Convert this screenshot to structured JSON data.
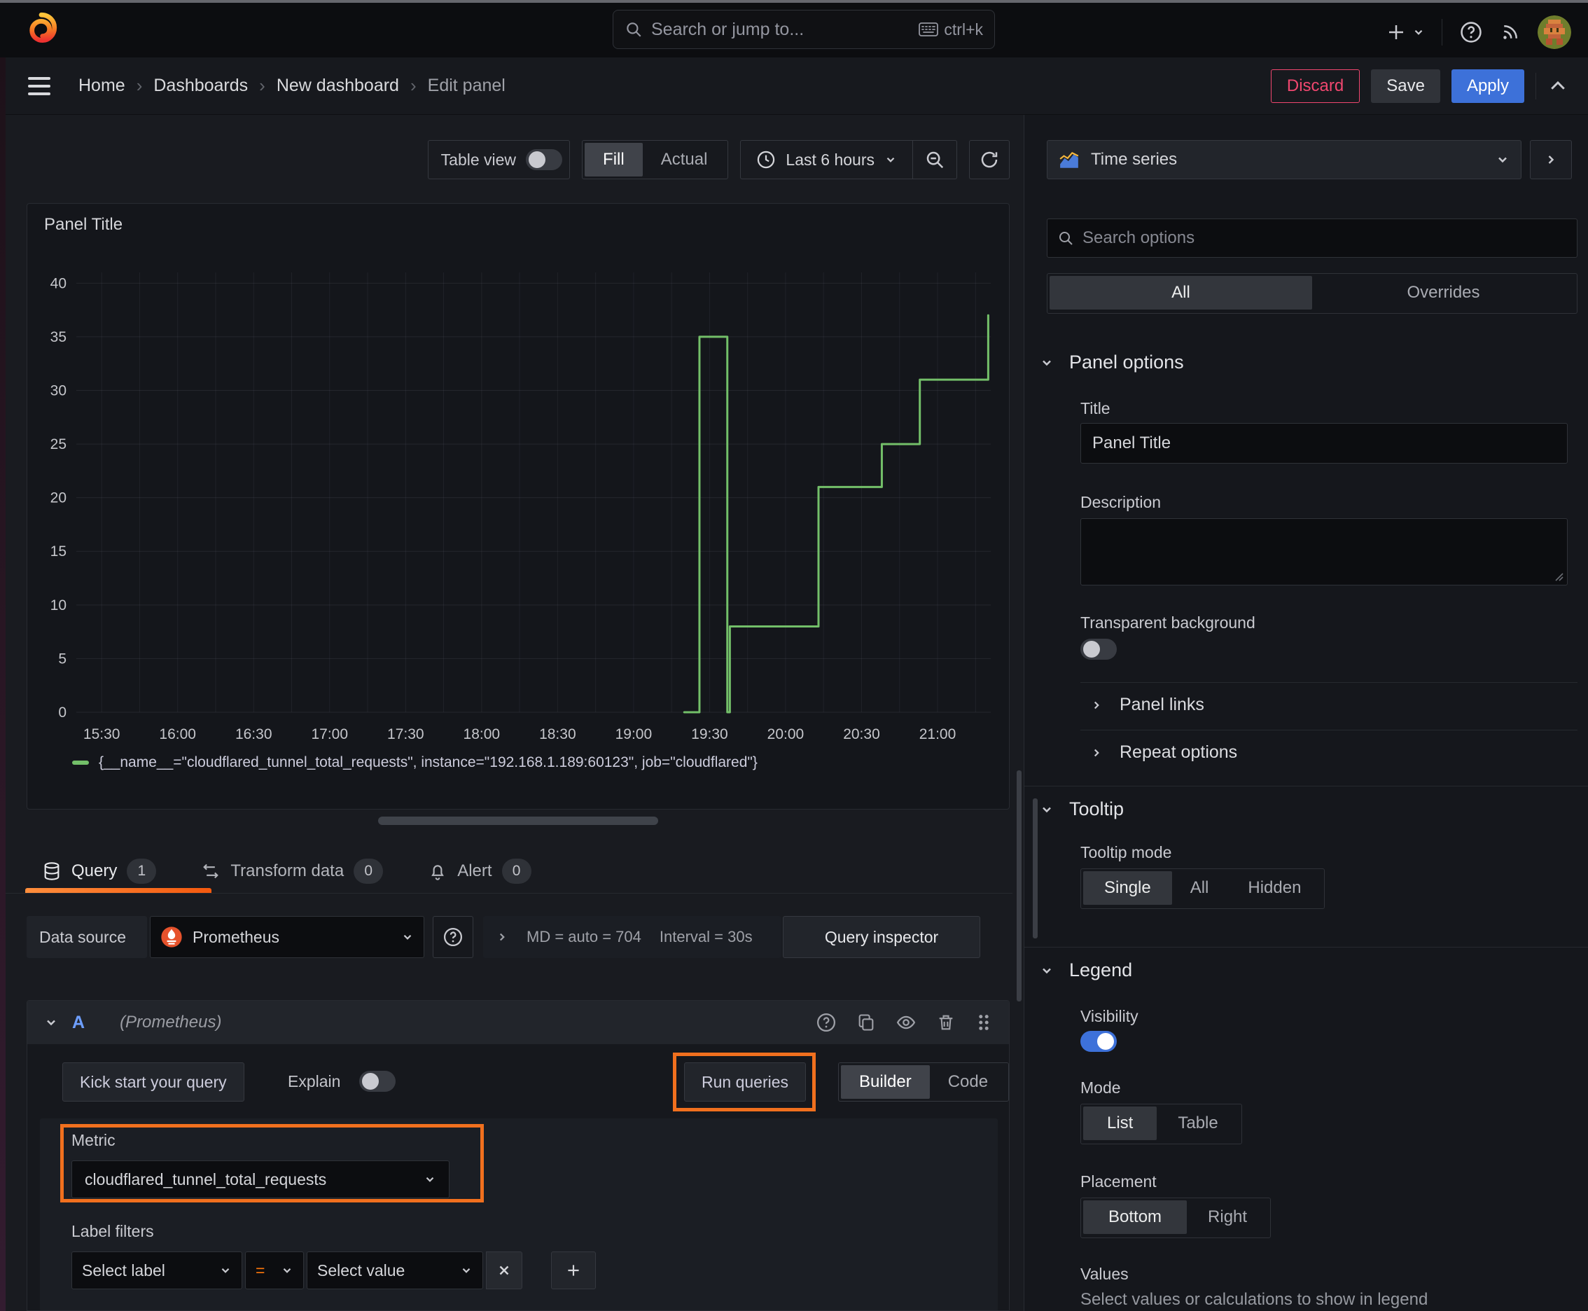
{
  "topbar": {
    "search_placeholder": "Search or jump to...",
    "search_shortcut": "ctrl+k"
  },
  "breadcrumb": {
    "items": [
      "Home",
      "Dashboards",
      "New dashboard",
      "Edit panel"
    ]
  },
  "header_actions": {
    "discard": "Discard",
    "save": "Save",
    "apply": "Apply"
  },
  "panel_toolbar": {
    "table_view": "Table view",
    "fill": "Fill",
    "actual": "Actual",
    "time_range": "Last 6 hours"
  },
  "viz_picker": {
    "label": "Time series"
  },
  "panel": {
    "title": "Panel Title"
  },
  "chart_data": {
    "type": "line",
    "line_interpolation": "step-after",
    "title": "Panel Title",
    "x_range": [
      "15:20",
      "21:21"
    ],
    "x_ticks": [
      "15:30",
      "16:00",
      "16:30",
      "17:00",
      "17:30",
      "18:00",
      "18:30",
      "19:00",
      "19:30",
      "20:00",
      "20:30",
      "21:00"
    ],
    "y_ticks": [
      0,
      5,
      10,
      15,
      20,
      25,
      30,
      35,
      40
    ],
    "ylim": [
      0,
      41
    ],
    "grid": true,
    "legend_position": "bottom",
    "series": [
      {
        "name": "{__name__=\"cloudflared_tunnel_total_requests\", instance=\"192.168.1.189:60123\", job=\"cloudflared\"}",
        "color": "#73bf69",
        "points": [
          [
            "19:20",
            0
          ],
          [
            "19:26",
            35
          ],
          [
            "19:37",
            0
          ],
          [
            "19:38",
            8
          ],
          [
            "20:13",
            21
          ],
          [
            "20:38",
            25
          ],
          [
            "20:53",
            31
          ],
          [
            "21:20",
            37
          ]
        ]
      }
    ]
  },
  "editor_tabs": {
    "query": {
      "label": "Query",
      "count": "1"
    },
    "transform": {
      "label": "Transform data",
      "count": "0"
    },
    "alert": {
      "label": "Alert",
      "count": "0"
    }
  },
  "datasource_row": {
    "label": "Data source",
    "value": "Prometheus",
    "stats": "MD = auto = 704",
    "interval": "Interval = 30s",
    "inspector": "Query inspector"
  },
  "query_editor": {
    "ref_id": "A",
    "ds_hint": "(Prometheus)",
    "kickstart": "Kick start your query",
    "explain": "Explain",
    "run": "Run queries",
    "builder": "Builder",
    "code": "Code",
    "metric_label": "Metric",
    "metric_value": "cloudflared_tunnel_total_requests",
    "label_filters": "Label filters",
    "select_label": "Select label",
    "operator": "=",
    "select_value": "Select value"
  },
  "sidebar": {
    "search_placeholder": "Search options",
    "tabs": {
      "all": "All",
      "overrides": "Overrides"
    },
    "panel_options": {
      "title": "Panel options",
      "title_label": "Title",
      "title_value": "Panel Title",
      "description_label": "Description",
      "transparent_label": "Transparent background"
    },
    "collapsed": {
      "panel_links": "Panel links",
      "repeat_options": "Repeat options"
    },
    "tooltip": {
      "title": "Tooltip",
      "mode_label": "Tooltip mode",
      "single": "Single",
      "all": "All",
      "hidden": "Hidden"
    },
    "legend": {
      "title": "Legend",
      "visibility_label": "Visibility",
      "mode_label": "Mode",
      "list": "List",
      "table": "Table",
      "placement_label": "Placement",
      "bottom": "Bottom",
      "right": "Right",
      "values_label": "Values",
      "values_hint": "Select values or calculations to show in legend"
    }
  },
  "colors": {
    "accent_blue": "#3d71d9",
    "highlight_orange": "#f1701e",
    "series_green": "#73bf69",
    "danger_pink": "#f0476f"
  }
}
